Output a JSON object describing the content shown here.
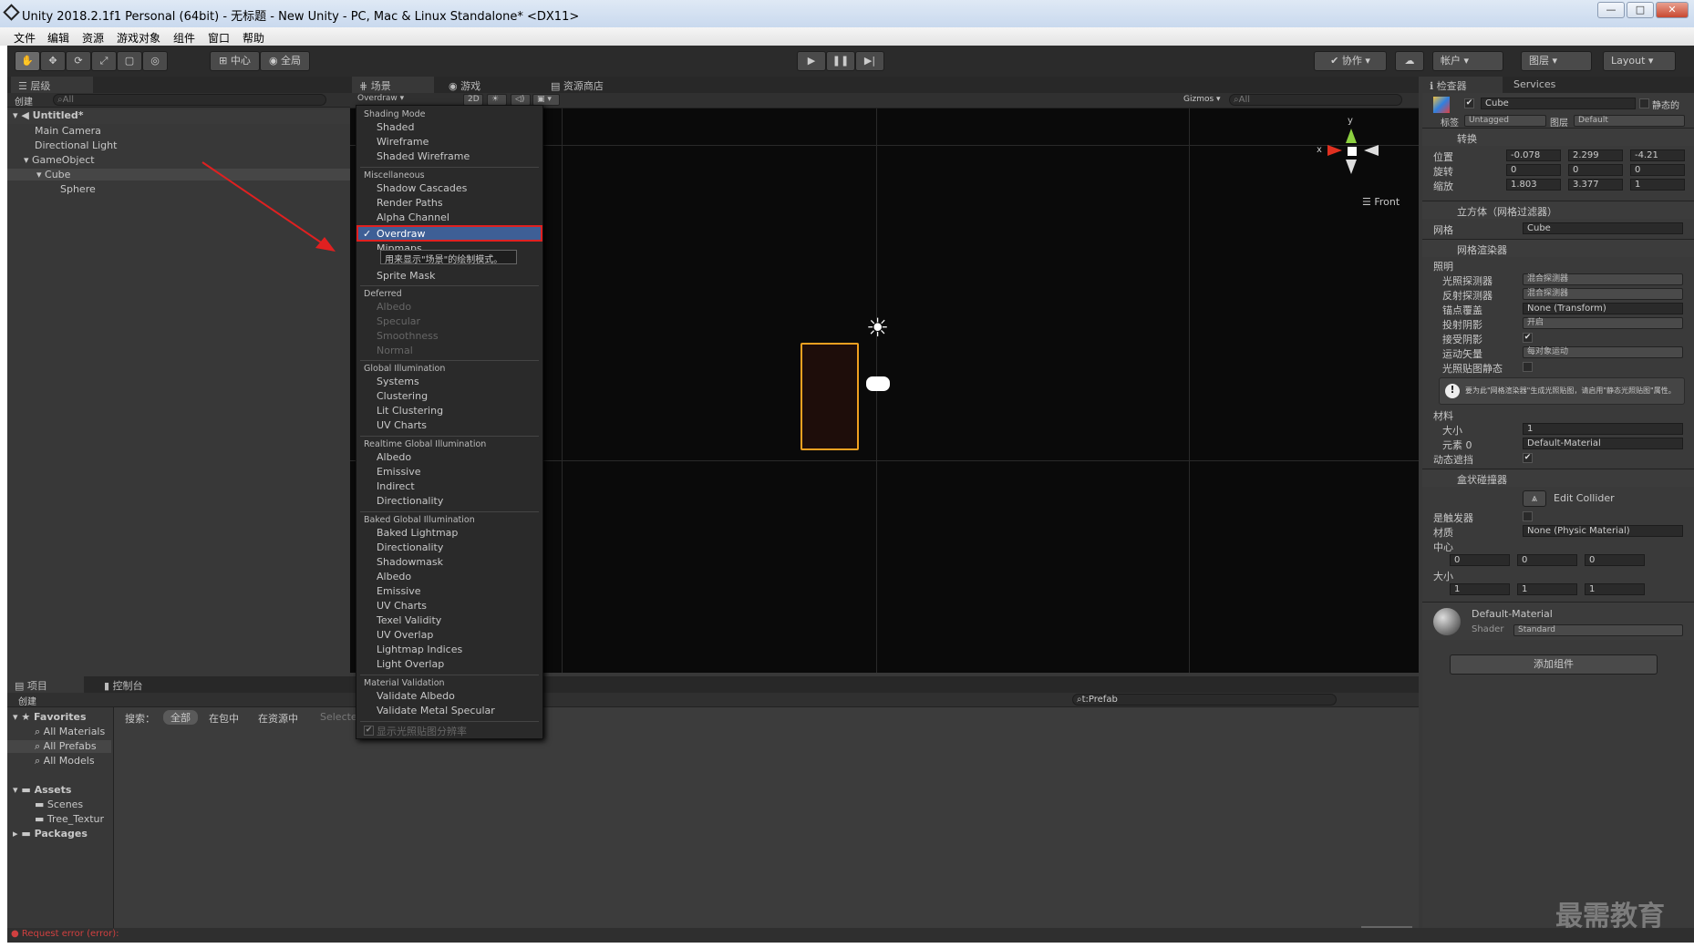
{
  "window": {
    "title": "Unity 2018.2.1f1 Personal (64bit) - 无标题 - New Unity - PC, Mac & Linux Standalone* <DX11>",
    "buttons": [
      "—",
      "□",
      "✕"
    ]
  },
  "menubar": [
    "文件",
    "编辑",
    "资源",
    "游戏对象",
    "组件",
    "窗口",
    "帮助"
  ],
  "toolbar": {
    "pivot": "中心",
    "space": "全局",
    "collab": "协作",
    "account": "帐户",
    "layers": "图层",
    "layout": "Layout"
  },
  "hierarchy": {
    "tab": "层级",
    "create": "创建",
    "search": "All",
    "scene": "Untitled*",
    "items": [
      "Main Camera",
      "Directional Light",
      "GameObject",
      "Cube",
      "Sphere"
    ]
  },
  "scene": {
    "tabs": [
      "场景",
      "游戏",
      "资源商店"
    ],
    "mode": "Overdraw",
    "btn2d": "2D",
    "gizmos": "Gizmos",
    "search": "All",
    "axisY": "y",
    "axisX": "x",
    "view": "Front"
  },
  "menu": {
    "sections": [
      {
        "header": "Shading Mode",
        "items": [
          "Shaded",
          "Wireframe",
          "Shaded Wireframe"
        ]
      },
      {
        "header": "Miscellaneous",
        "items": [
          "Shadow Cascades",
          "Render Paths",
          "Alpha Channel",
          "Overdraw",
          "Mipmaps"
        ]
      },
      {
        "header": "",
        "items": [
          "Sprite Mask"
        ]
      },
      {
        "header": "Deferred",
        "items": [
          "Albedo",
          "Specular",
          "Smoothness",
          "Normal"
        ]
      },
      {
        "header": "Global Illumination",
        "items": [
          "Systems",
          "Clustering",
          "Lit Clustering",
          "UV Charts"
        ]
      },
      {
        "header": "Realtime Global Illumination",
        "items": [
          "Albedo",
          "Emissive",
          "Indirect",
          "Directionality"
        ]
      },
      {
        "header": "Baked Global Illumination",
        "items": [
          "Baked Lightmap",
          "Directionality",
          "Shadowmask",
          "Albedo",
          "Emissive",
          "UV Charts",
          "Texel Validity",
          "UV Overlap",
          "Lightmap Indices",
          "Light Overlap"
        ]
      },
      {
        "header": "Material Validation",
        "items": [
          "Validate Albedo",
          "Validate Metal Specular"
        ]
      }
    ],
    "tooltip": "用来显示\"场景\"的绘制模式。",
    "footer": "显示光照贴图分辨率",
    "selected": "Overdraw"
  },
  "inspector": {
    "tab": "检查器",
    "tab2": "Services",
    "name": "Cube",
    "static": "静态的",
    "tagLabel": "标签",
    "tag": "Untagged",
    "layerLabel": "图层",
    "layer": "Default",
    "transform": {
      "title": "转换",
      "position": {
        "label": "位置",
        "x": "-0.078",
        "y": "2.299",
        "z": "-4.21"
      },
      "rotation": {
        "label": "旋转",
        "x": "0",
        "y": "0",
        "z": "0"
      },
      "scale": {
        "label": "缩放",
        "x": "1.803",
        "y": "3.377",
        "z": "1"
      }
    },
    "meshFilter": {
      "title": "立方体（网格过滤器）",
      "meshLabel": "网格",
      "mesh": "Cube"
    },
    "meshRenderer": {
      "title": "网格渲染器",
      "lighting": "照明",
      "rows": [
        [
          "光照探测器",
          "混合探测器"
        ],
        [
          "反射探测器",
          "混合探测器"
        ],
        [
          "锚点覆盖",
          "None (Transform)"
        ],
        [
          "投射阴影",
          "开启"
        ],
        [
          "接受阴影",
          ""
        ],
        [
          "运动矢量",
          "每对象运动"
        ],
        [
          "光照贴图静态",
          ""
        ]
      ],
      "info": "要为此\"网格渲染器\"生成光照贴图，请启用\"静态光照贴图\"属性。",
      "materials": "材料",
      "sizeLabel": "大小",
      "size": "1",
      "elemLabel": "元素 0",
      "elem": "Default-Material",
      "dynOcc": "动态遮挡"
    },
    "boxCollider": {
      "title": "盒状碰撞器",
      "edit": "Edit Collider",
      "trigger": "是触发器",
      "matLabel": "材质",
      "mat": "None (Physic Material)",
      "center": "中心",
      "cx": "0",
      "cy": "0",
      "cz": "0",
      "size": "大小",
      "sx": "1",
      "sy": "1",
      "sz": "1"
    },
    "material": {
      "name": "Default-Material",
      "shaderLabel": "Shader",
      "shader": "Standard"
    },
    "addComponent": "添加组件"
  },
  "project": {
    "tabs": [
      "项目",
      "控制台"
    ],
    "create": "创建",
    "search": "t:Prefab",
    "searchLabel": "搜索：",
    "filters": [
      "全部",
      "在包中",
      "在资源中",
      "Selected"
    ],
    "favorites": "Favorites",
    "favItems": [
      "All Materials",
      "All Prefabs",
      "All Models"
    ],
    "assets": "Assets",
    "assetItems": [
      "Scenes",
      "Tree_Textur"
    ],
    "packages": "Packages"
  },
  "status": "Request error (error):",
  "watermark": "最需教育",
  "colors": {
    "accent": "#3e5f96",
    "highlight": "#e02020",
    "selection": "#f0a020"
  }
}
